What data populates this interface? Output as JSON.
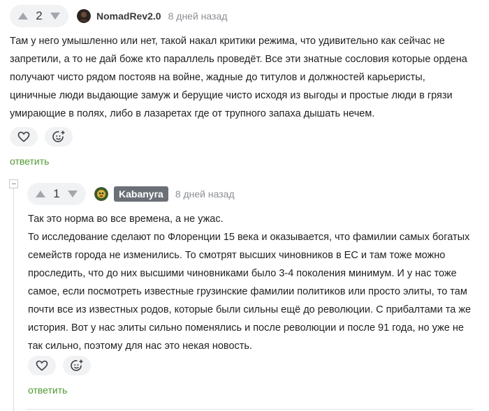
{
  "comments": [
    {
      "rating": "2",
      "username": "NomadRev2.0",
      "time": "8 дней назад",
      "lines": [
        "Там у него умышленно или нет, такой накал критики режима, что удивительно как сейчас не",
        "запретили, а то не дай боже кто параллель проведёт. Все эти знатные сословия которые ордена",
        "получают чисто рядом постояв на войне, жадные до титулов и должностей карьеристы,",
        "циничные люди выдающие замуж и берущие чисто исходя из выгоды и простые люди в грязи",
        "умирающие в полях, либо в лазаретах где от трупного запаха дышать нечем."
      ],
      "reply_label": "ответить"
    },
    {
      "rating": "1",
      "username": "Kabanyra",
      "time": "8 дней назад",
      "lines": [
        "Так это норма во все времена, а не ужас.",
        "То исследование сделают по Флоренции 15 века и оказывается, что фамилии самых богатых",
        "семейств города не изменились. То смотрят высших чиновников в ЕС и там тоже можно",
        "проследить, что до них высшими чиновниками было 3-4 поколения минимум. И у нас тоже",
        "самое, если посмотреть известные грузинские фамилии политиков или просто элиты, то там",
        "почти все из известных родов, которые были сильны ещё до революции. С прибалтами та же",
        "история. Вот у нас элиты сильно поменялись и после революции и после 91 года, но уже не",
        "так сильно, поэтому для нас это некая новость."
      ],
      "reply_label": "ответить"
    }
  ],
  "icons": {
    "upvote": "upvote-arrow-icon",
    "downvote": "downvote-arrow-icon",
    "like": "heart-icon",
    "reaction": "add-reaction-icon",
    "collapse": "collapse-thread-icon"
  },
  "colors": {
    "reply_link": "#4f9a33",
    "arrow": "#a3a7ad",
    "badge": "#6b6f76"
  }
}
